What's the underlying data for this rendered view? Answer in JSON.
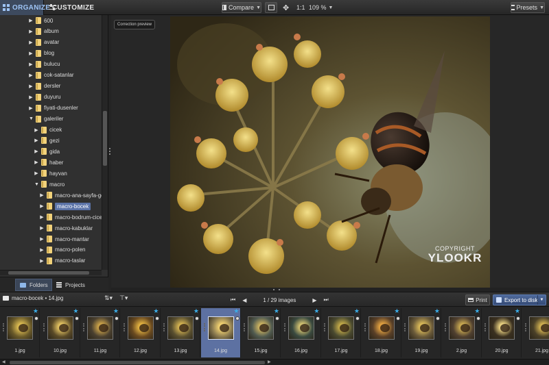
{
  "tabs": {
    "organize": "ORGANIZE",
    "customize": "CUSTOMIZE"
  },
  "toolbar": {
    "compare": "Compare",
    "ratio": "1:1",
    "zoom": "109 %",
    "presets": "Presets"
  },
  "preview_label": "Correction preview",
  "tree": [
    {
      "label": "600",
      "level": 0,
      "expanded": false
    },
    {
      "label": "album",
      "level": 0,
      "expanded": false
    },
    {
      "label": "avatar",
      "level": 0,
      "expanded": false
    },
    {
      "label": "blog",
      "level": 0,
      "expanded": false
    },
    {
      "label": "bulucu",
      "level": 0,
      "expanded": false
    },
    {
      "label": "cok-satanlar",
      "level": 0,
      "expanded": false
    },
    {
      "label": "dersler",
      "level": 0,
      "expanded": false
    },
    {
      "label": "duyuru",
      "level": 0,
      "expanded": false
    },
    {
      "label": "fiyati-dusenler",
      "level": 0,
      "expanded": false
    },
    {
      "label": "galeriler",
      "level": 0,
      "expanded": true
    },
    {
      "label": "cicek",
      "level": 1,
      "expanded": false
    },
    {
      "label": "gezi",
      "level": 1,
      "expanded": false
    },
    {
      "label": "gida",
      "level": 1,
      "expanded": false
    },
    {
      "label": "haber",
      "level": 1,
      "expanded": false
    },
    {
      "label": "hayvan",
      "level": 1,
      "expanded": false
    },
    {
      "label": "macro",
      "level": 1,
      "expanded": true
    },
    {
      "label": "macro-ana-sayfa-genel",
      "level": 2,
      "expanded": false
    },
    {
      "label": "macro-bocek",
      "level": 2,
      "expanded": false,
      "selected": true
    },
    {
      "label": "macro-bodrum-cicekleri",
      "level": 2,
      "expanded": false
    },
    {
      "label": "macro-kabuklar",
      "level": 2,
      "expanded": false
    },
    {
      "label": "macro-mantar",
      "level": 2,
      "expanded": false
    },
    {
      "label": "macro-polen",
      "level": 2,
      "expanded": false
    },
    {
      "label": "macro-taslar",
      "level": 2,
      "expanded": false
    }
  ],
  "panel_tabs": {
    "folders": "Folders",
    "projects": "Projects"
  },
  "copyright": {
    "line1": "COPYRIGHT",
    "line2": "YLOOKR"
  },
  "stripbar": {
    "path": "macro-bocek • 14.jpg",
    "counter": "1 / 29  images",
    "print": "Print",
    "export": "Export to disk"
  },
  "thumbnails": [
    {
      "name": "1.jpg"
    },
    {
      "name": "10.jpg"
    },
    {
      "name": "11.jpg"
    },
    {
      "name": "12.jpg"
    },
    {
      "name": "13.jpg"
    },
    {
      "name": "14.jpg",
      "selected": true
    },
    {
      "name": "15.jpg"
    },
    {
      "name": "16.jpg"
    },
    {
      "name": "17.jpg"
    },
    {
      "name": "18.jpg"
    },
    {
      "name": "19.jpg"
    },
    {
      "name": "2.jpg"
    },
    {
      "name": "20.jpg"
    },
    {
      "name": "21.jpg"
    }
  ],
  "colors": {
    "accent": "#5b73a8",
    "star": "#3aaeea",
    "export": "#4f6a9c"
  }
}
